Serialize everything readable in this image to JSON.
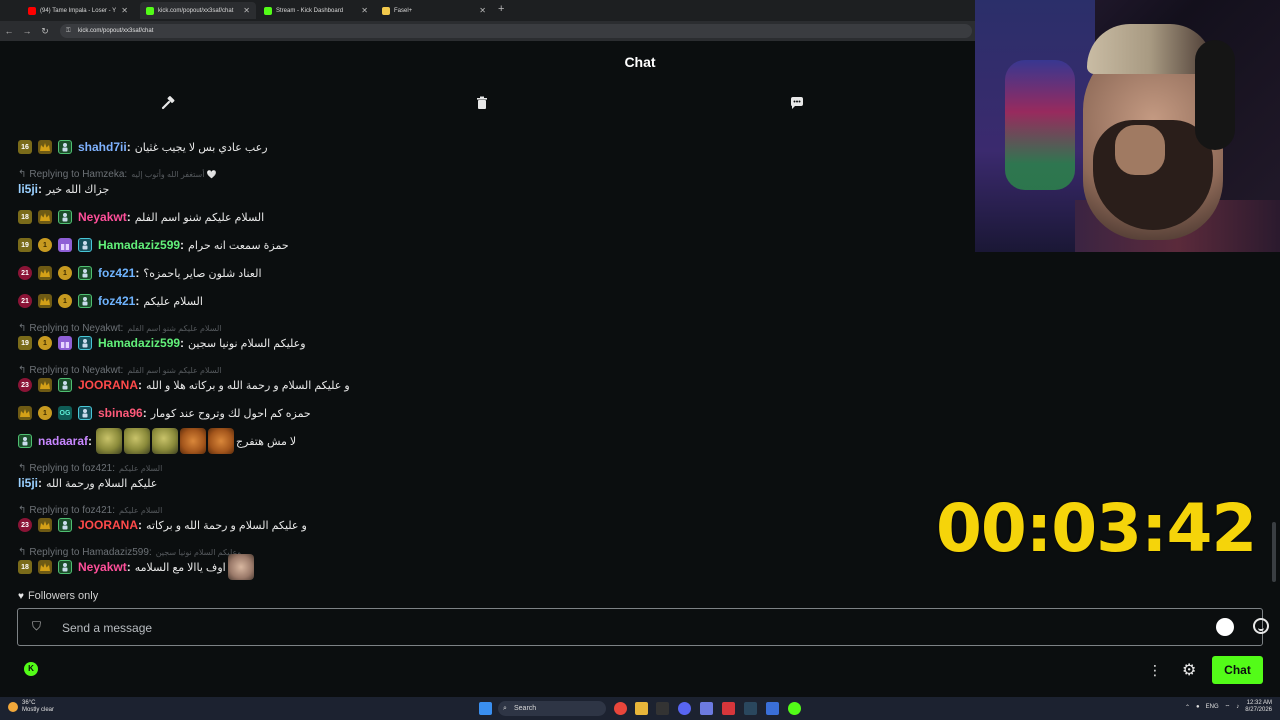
{
  "browser": {
    "tabs": [
      {
        "title": "(94) Tame Impala - Loser - Y",
        "icon_color": "#ff0000",
        "active": false
      },
      {
        "title": "kick.com/popout/xx3saf/chat",
        "icon_color": "#53fc18",
        "active": true
      },
      {
        "title": "Stream - Kick Dashboard",
        "icon_color": "#53fc18",
        "active": false
      },
      {
        "title": "Fasel+",
        "icon_color": "#f2c94c",
        "active": false
      }
    ],
    "url": "kick.com/popout/xx3saf/chat"
  },
  "chat": {
    "title": "Chat",
    "header_icons": [
      "hammer-icon",
      "trash-icon",
      "chat-bubble-icon"
    ],
    "messages": [
      {
        "type": "msg",
        "badges": [
          {
            "kind": "sub",
            "text": "16"
          },
          {
            "kind": "crown",
            "text": ""
          },
          {
            "kind": "mod",
            "text": ""
          }
        ],
        "user": "shahd7ii",
        "color": "#7fb2ff",
        "text": "رعب عادي بس لا يجيب غثيان"
      },
      {
        "type": "reply",
        "to": "Replying to Hamzeka:",
        "quote": "أستغفر الله وأتوب إليه 🤍"
      },
      {
        "type": "msg",
        "badges": [],
        "user": "li5ji",
        "color": "#9ad0ff",
        "text": "جزاك الله خير"
      },
      {
        "type": "msg",
        "badges": [
          {
            "kind": "sub",
            "text": "18"
          },
          {
            "kind": "crown",
            "text": ""
          },
          {
            "kind": "mod",
            "text": ""
          }
        ],
        "user": "Neyakwt",
        "color": "#ff4f9a",
        "text": "السلام عليكم شنو اسم الفلم"
      },
      {
        "type": "msg",
        "badges": [
          {
            "kind": "sub",
            "text": "19"
          },
          {
            "kind": "coin",
            "text": "1"
          },
          {
            "kind": "gift",
            "text": ""
          },
          {
            "kind": "vip",
            "text": ""
          }
        ],
        "user": "Hamadaziz599",
        "color": "#62f07a",
        "text": "حمزة سمعت انه حرام"
      },
      {
        "type": "msg",
        "badges": [
          {
            "kind": "sub21",
            "text": "21"
          },
          {
            "kind": "crown",
            "text": ""
          },
          {
            "kind": "coin",
            "text": "1"
          },
          {
            "kind": "mod",
            "text": ""
          }
        ],
        "user": "foz421",
        "color": "#6fb4ff",
        "text": "العناد شلون صاير ياحمزه؟"
      },
      {
        "type": "msg",
        "badges": [
          {
            "kind": "sub21",
            "text": "21"
          },
          {
            "kind": "crown",
            "text": ""
          },
          {
            "kind": "coin",
            "text": "1"
          },
          {
            "kind": "mod",
            "text": ""
          }
        ],
        "user": "foz421",
        "color": "#6fb4ff",
        "text": "السلام عليكم"
      },
      {
        "type": "reply",
        "to": "Replying to Neyakwt:",
        "quote": "السلام عليكم شنو اسم الفلم"
      },
      {
        "type": "msg",
        "badges": [
          {
            "kind": "sub",
            "text": "19"
          },
          {
            "kind": "coin",
            "text": "1"
          },
          {
            "kind": "gift",
            "text": ""
          },
          {
            "kind": "vip",
            "text": ""
          }
        ],
        "user": "Hamadaziz599",
        "color": "#62f07a",
        "text": "وعليكم السلام نونيا سجين"
      },
      {
        "type": "reply",
        "to": "Replying to Neyakwt:",
        "quote": "السلام عليكم شنو اسم الفلم"
      },
      {
        "type": "msg",
        "badges": [
          {
            "kind": "sub21",
            "text": "23"
          },
          {
            "kind": "crown",
            "text": ""
          },
          {
            "kind": "mod",
            "text": ""
          }
        ],
        "user": "JOORANA",
        "color": "#ff4a4a",
        "text": "و عليكم السلام و رحمة الله و بركاته هلا و الله"
      },
      {
        "type": "msg",
        "badges": [
          {
            "kind": "crown",
            "text": ""
          },
          {
            "kind": "coin",
            "text": "1"
          },
          {
            "kind": "og",
            "text": "OG"
          },
          {
            "kind": "vip",
            "text": ""
          }
        ],
        "user": "sbina96",
        "color": "#ff5a7a",
        "text": "حمزه كم احول لك وتروح عند كومار"
      },
      {
        "type": "msg_emotes",
        "badges": [
          {
            "kind": "mod",
            "text": ""
          }
        ],
        "user": "nadaaraf",
        "color": "#c887ff",
        "emotes": [
          "green",
          "green",
          "green",
          "cat",
          "cat"
        ],
        "text": "لا مش هتفرج"
      },
      {
        "type": "reply",
        "to": "Replying to foz421:",
        "quote": "السلام عليكم"
      },
      {
        "type": "msg",
        "badges": [],
        "user": "li5ji",
        "color": "#9ad0ff",
        "text": "عليكم السلام ورحمة الله"
      },
      {
        "type": "reply",
        "to": "Replying to foz421:",
        "quote": "السلام عليكم"
      },
      {
        "type": "msg",
        "badges": [
          {
            "kind": "sub21",
            "text": "23"
          },
          {
            "kind": "crown",
            "text": ""
          },
          {
            "kind": "mod",
            "text": ""
          }
        ],
        "user": "JOORANA",
        "color": "#ff4a4a",
        "text": "و عليكم السلام و رحمة الله و بركاته"
      },
      {
        "type": "reply",
        "to": "Replying to Hamadaziz599:",
        "quote": "وعليكم السلام نونيا سجين"
      },
      {
        "type": "msg_emote_end",
        "badges": [
          {
            "kind": "sub",
            "text": "18"
          },
          {
            "kind": "crown",
            "text": ""
          },
          {
            "kind": "mod",
            "text": ""
          }
        ],
        "user": "Neyakwt",
        "color": "#ff4f9a",
        "text": "اوف ياالا مع السلامه",
        "emote": "face"
      }
    ],
    "followers_only": "Followers only",
    "input_placeholder": "Send a message",
    "send_label": "Chat"
  },
  "overlay": {
    "timer": "00:03:42"
  },
  "taskbar": {
    "weather_temp": "36°C",
    "weather_desc": "Mostly clear",
    "search_label": "Search",
    "lang": "ENG",
    "time": "12:32 AM",
    "date": "8/27/2026"
  },
  "colors": {
    "accent": "#53fc18",
    "timer": "#f5d40a",
    "background": "#0b0e0f"
  }
}
